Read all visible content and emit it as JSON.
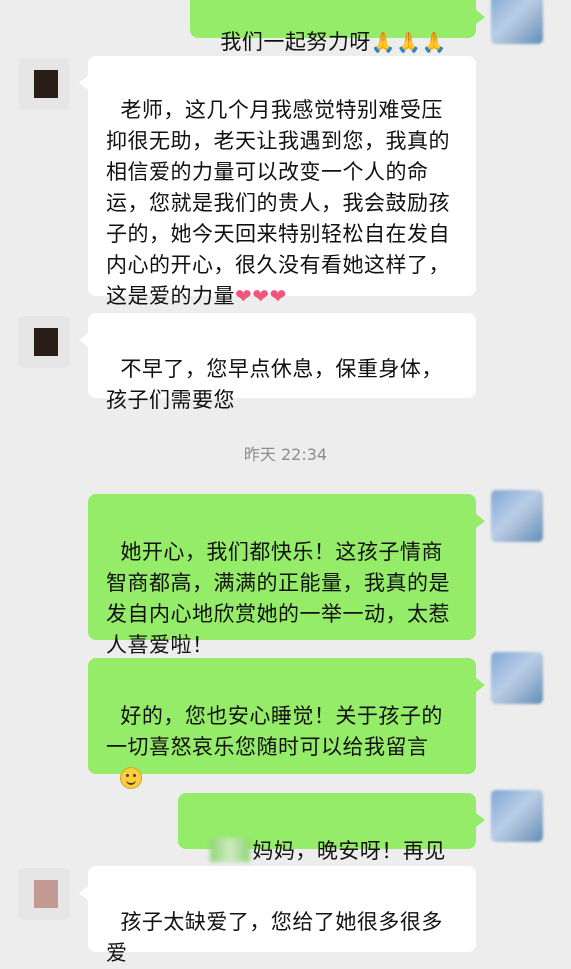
{
  "messages": [
    {
      "side": "right",
      "text": "我们一起努力呀",
      "emoji": "🙏🙏🙏"
    },
    {
      "side": "left",
      "text": "老师，这几个月我感觉特别难受压抑很无助，老天让我遇到您，我真的相信爱的力量可以改变一个人的命运，您就是我们的贵人，我会鼓励孩子的，她今天回来特别轻松自在发自内心的开心，很久没有看她这样了，这是爱的力量",
      "emoji": "❤❤❤"
    },
    {
      "side": "left",
      "text": "不早了，您早点休息，保重身体，孩子们需要您"
    },
    {
      "side": "right",
      "text": "她开心，我们都快乐！这孩子情商智商都高，满满的正能量，我真的是发自内心地欣赏她的一举一动，太惹人喜爱啦！"
    },
    {
      "side": "right",
      "text": "好的，您也安心睡觉！关于孩子的一切喜怒哀乐您随时可以给我留言",
      "emoji": "smiley"
    },
    {
      "side": "right",
      "text": "妈妈，晚安呀！再见"
    },
    {
      "side": "left",
      "text": "孩子太缺爱了，您给了她很多很多爱"
    }
  ],
  "timestamp": "昨天 22:34",
  "colors": {
    "background": "#ededed",
    "outgoing_bubble": "#95ec69",
    "incoming_bubble": "#ffffff",
    "timestamp_text": "#8d8d8d"
  },
  "icons": {
    "pray": "folded-hands-emoji",
    "heart": "heart-emoji",
    "smile": "smiley-emoji"
  }
}
